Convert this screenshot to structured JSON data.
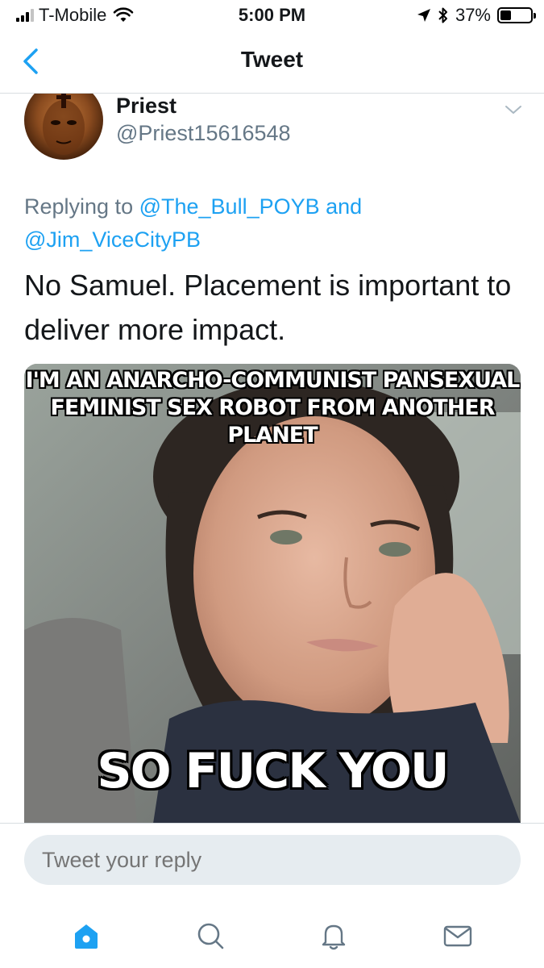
{
  "status_bar": {
    "carrier": "T-Mobile",
    "time": "5:00 PM",
    "battery_percent_text": "37%",
    "battery_level": 0.37,
    "signal_bars_filled": 3,
    "signal_bars_total": 4
  },
  "nav": {
    "title": "Tweet",
    "back_icon": "chevron-left-icon"
  },
  "tweet": {
    "display_name": "Priest",
    "handle": "@Priest15616548",
    "reply_prefix": "Replying to ",
    "mention_1": "@The_Bull_POYB",
    "reply_and": " and ",
    "mention_2": "@Jim_ViceCityPB",
    "text": "No Samuel. Placement is important to deliver more impact.",
    "media": {
      "top_caption_line1": "I'M AN ANARCHO-COMMUNIST PANSEXUAL",
      "top_caption_line2": "FEMINIST SEX ROBOT FROM ANOTHER PLANET",
      "bottom_caption": "SO FUCK YOU"
    }
  },
  "composer": {
    "placeholder": "Tweet your reply"
  },
  "tabs": [
    {
      "name": "home",
      "icon": "home-icon",
      "active": true
    },
    {
      "name": "search",
      "icon": "search-icon",
      "active": false
    },
    {
      "name": "notifications",
      "icon": "bell-icon",
      "active": false
    },
    {
      "name": "messages",
      "icon": "envelope-icon",
      "active": false
    }
  ],
  "colors": {
    "accent": "#1da1f2",
    "secondary_text": "#657786",
    "divider": "#d8dde1",
    "input_bg": "#e6ecf0"
  }
}
